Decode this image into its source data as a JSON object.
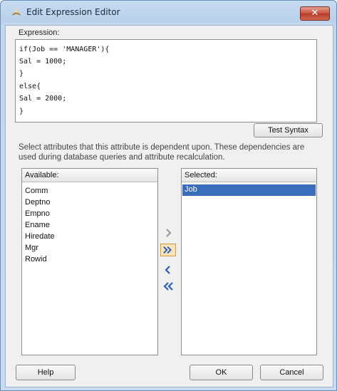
{
  "window": {
    "title": "Edit Expression Editor",
    "close_label": "✕"
  },
  "expression": {
    "label": "Expression:",
    "lines": [
      "if(Job == 'MANAGER'){",
      "Sal = 1000;",
      "}",
      "else{",
      "Sal = 2000;",
      "}"
    ]
  },
  "test_syntax_label": "Test Syntax",
  "instructions": [
    "Select attributes that this attribute is dependent upon. These dependencies are",
    "used during database queries and attribute recalculation."
  ],
  "available": {
    "header": "Available:",
    "items": [
      "Comm",
      "Deptno",
      "Empno",
      "Ename",
      "Hiredate",
      "Mgr",
      "Rowid"
    ]
  },
  "selected": {
    "header": "Selected:",
    "items": [
      "Job"
    ]
  },
  "footer": {
    "help_label": "Help",
    "ok_label": "OK",
    "cancel_label": "Cancel"
  },
  "colors": {
    "selection": "#3a6dbb",
    "arrow_active": "#2f5fb8",
    "arrow_disabled": "#9a9a9a"
  }
}
